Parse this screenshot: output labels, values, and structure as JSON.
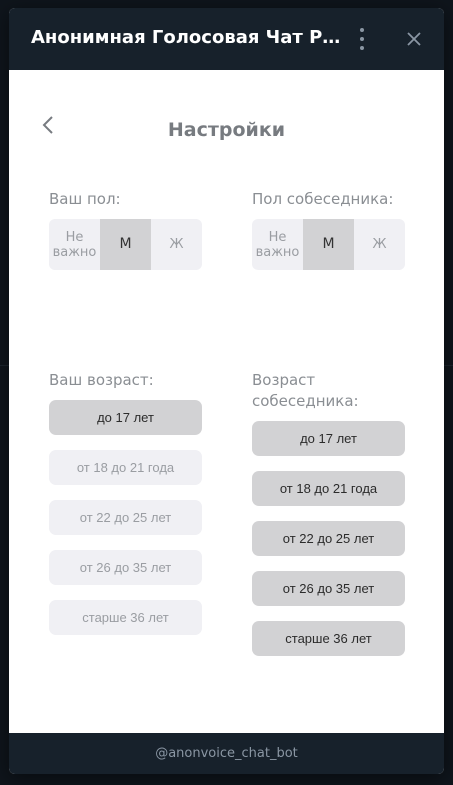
{
  "modal": {
    "title": "Анонимная Голосовая Чат Руле...",
    "page_title": "Настройки",
    "footer": "@anonvoice_chat_bot"
  },
  "gender": {
    "mine_label": "Ваш пол:",
    "partner_label": "Пол собеседника:",
    "options": [
      "Не важно",
      "М",
      "Ж"
    ],
    "mine_selected": "М",
    "partner_selected": "М"
  },
  "age": {
    "mine_label": "Ваш возраст:",
    "partner_label": "Возраст собеседника:",
    "options": [
      "до 17 лет",
      "от 18 до 21 года",
      "от 22 до 25 лет",
      "от 26 до 35 лет",
      "старше 36 лет"
    ],
    "mine_selected": "до 17 лет",
    "partner_selected": [
      "до 17 лет",
      "от 18 до 21 года",
      "от 22 до 25 лет",
      "от 26 до 35 лет",
      "старше 36 лет"
    ]
  },
  "icons": {
    "menu": "kebab-menu-icon",
    "close": "close-icon",
    "back": "chevron-left-icon"
  }
}
